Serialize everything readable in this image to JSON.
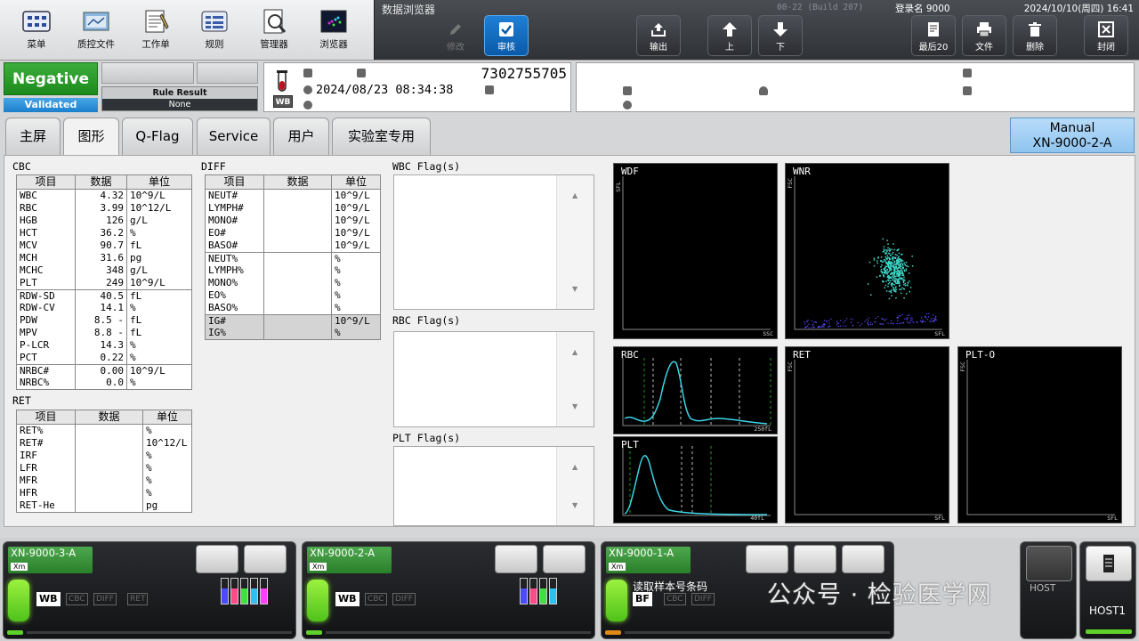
{
  "toolbar": {
    "items": [
      {
        "label": "菜单",
        "icon": "menu-grid-icon"
      },
      {
        "label": "质控文件",
        "icon": "qc-folder-icon"
      },
      {
        "label": "工作单",
        "icon": "worksheet-icon"
      },
      {
        "label": "规则",
        "icon": "rules-icon"
      },
      {
        "label": "管理器",
        "icon": "manager-icon"
      },
      {
        "label": "浏览器",
        "icon": "browser-icon"
      }
    ]
  },
  "browser": {
    "title": "数据浏览器",
    "build": "00-22 (Build 207)",
    "login": "登录名 9000",
    "datetime": "2024/10/10(周四) 16:41",
    "buttons": {
      "edit": "修改",
      "verify": "审核",
      "output": "输出",
      "up": "上",
      "down": "下",
      "last20": "最后20",
      "file": "文件",
      "delete": "删除",
      "close": "封闭"
    }
  },
  "status": {
    "result": "Negative",
    "validated": "Validated",
    "rule_result_label": "Rule Result",
    "rule_result_value": "None"
  },
  "sample": {
    "number": "7302755705",
    "datetime": "2024/08/23 08:34:38",
    "type": "WB"
  },
  "tabs": [
    "主屏",
    "图形",
    "Q-Flag",
    "Service",
    "用户",
    "实验室专用"
  ],
  "active_tab": "图形",
  "manual": {
    "line1": "Manual",
    "line2": "XN-9000-2-A"
  },
  "cbc": {
    "title": "CBC",
    "headers": [
      "项目",
      "数据",
      "单位"
    ],
    "groups": [
      [
        {
          "item": "WBC",
          "value": "4.32",
          "unit": "10^9/L"
        },
        {
          "item": "RBC",
          "value": "3.99",
          "unit": "10^12/L"
        },
        {
          "item": "HGB",
          "value": "126",
          "unit": "g/L"
        },
        {
          "item": "HCT",
          "value": "36.2",
          "unit": "%"
        },
        {
          "item": "MCV",
          "value": "90.7",
          "unit": "fL"
        },
        {
          "item": "MCH",
          "value": "31.6",
          "unit": "pg"
        },
        {
          "item": "MCHC",
          "value": "348",
          "unit": "g/L"
        },
        {
          "item": "PLT",
          "value": "249",
          "unit": "10^9/L"
        }
      ],
      [
        {
          "item": "RDW-SD",
          "value": "40.5",
          "unit": "fL"
        },
        {
          "item": "RDW-CV",
          "value": "14.1",
          "unit": "%"
        },
        {
          "item": "PDW",
          "value": "8.5 -",
          "unit": "fL"
        },
        {
          "item": "MPV",
          "value": "8.8 -",
          "unit": "fL"
        },
        {
          "item": "P-LCR",
          "value": "14.3",
          "unit": "%"
        },
        {
          "item": "PCT",
          "value": "0.22",
          "unit": "%"
        }
      ],
      [
        {
          "item": "NRBC#",
          "value": "0.00",
          "unit": "10^9/L"
        },
        {
          "item": "NRBC%",
          "value": "0.0",
          "unit": "%"
        }
      ]
    ]
  },
  "ret": {
    "title": "RET",
    "headers": [
      "项目",
      "数据",
      "单位"
    ],
    "rows": [
      {
        "item": "RET%",
        "value": "",
        "unit": "%"
      },
      {
        "item": "RET#",
        "value": "",
        "unit": "10^12/L"
      },
      {
        "item": "IRF",
        "value": "",
        "unit": "%"
      },
      {
        "item": "LFR",
        "value": "",
        "unit": "%"
      },
      {
        "item": "MFR",
        "value": "",
        "unit": "%"
      },
      {
        "item": "HFR",
        "value": "",
        "unit": "%"
      },
      {
        "item": "RET-He",
        "value": "",
        "unit": "pg"
      }
    ]
  },
  "diff": {
    "title": "DIFF",
    "headers": [
      "项目",
      "数据",
      "单位"
    ],
    "groups": [
      [
        {
          "item": "NEUT#",
          "value": "",
          "unit": "10^9/L"
        },
        {
          "item": "LYMPH#",
          "value": "",
          "unit": "10^9/L"
        },
        {
          "item": "MONO#",
          "value": "",
          "unit": "10^9/L"
        },
        {
          "item": "EO#",
          "value": "",
          "unit": "10^9/L"
        },
        {
          "item": "BASO#",
          "value": "",
          "unit": "10^9/L"
        }
      ],
      [
        {
          "item": "NEUT%",
          "value": "",
          "unit": "%"
        },
        {
          "item": "LYMPH%",
          "value": "",
          "unit": "%"
        },
        {
          "item": "MONO%",
          "value": "",
          "unit": "%"
        },
        {
          "item": "EO%",
          "value": "",
          "unit": "%"
        },
        {
          "item": "BASO%",
          "value": "",
          "unit": "%"
        }
      ],
      [
        {
          "item": "IG#",
          "value": "",
          "unit": "10^9/L"
        },
        {
          "item": "IG%",
          "value": "",
          "unit": "%"
        }
      ]
    ]
  },
  "flags": {
    "wbc": "WBC Flag(s)",
    "rbc": "RBC Flag(s)",
    "plt": "PLT Flag(s)"
  },
  "plots": {
    "wdf": {
      "title": "WDF",
      "y_axis": "SFL",
      "x_axis": "SSC"
    },
    "wnr": {
      "title": "WNR",
      "y_axis": "FSC",
      "x_axis": "SFL"
    },
    "rbc": {
      "title": "RBC",
      "x_axis": "250fL"
    },
    "plt": {
      "title": "PLT",
      "x_axis": "40fL"
    },
    "ret": {
      "title": "RET",
      "y_axis": "FSC",
      "x_axis": "SFL"
    },
    "plto": {
      "title": "PLT-O",
      "y_axis": "FSC",
      "x_axis": "SFL"
    }
  },
  "instruments": [
    {
      "name": "XN-9000-3-A",
      "tag": "Xm",
      "sample_type": "WB",
      "modes": [
        "CBC",
        "DIFF",
        "RET"
      ],
      "status": ""
    },
    {
      "name": "XN-9000-2-A",
      "tag": "Xm",
      "sample_type": "WB",
      "modes": [
        "CBC",
        "DIFF"
      ],
      "status": ""
    },
    {
      "name": "XN-9000-1-A",
      "tag": "Xm",
      "sample_type": "BF",
      "modes": [
        "CBC",
        "DIFF"
      ],
      "status": "读取样本号条码"
    }
  ],
  "hosts": [
    {
      "label": "HOST"
    },
    {
      "label": "HOST1"
    }
  ],
  "watermark": "公众号 · 检验医学网",
  "colors": {
    "negative": "#2a9a2a",
    "validated": "#2a8ad6",
    "scatter": "#3fd8c8",
    "histogram": "#3ad6e6",
    "discriminator": "#1aa01a",
    "instrument_led": "#7be02a"
  }
}
